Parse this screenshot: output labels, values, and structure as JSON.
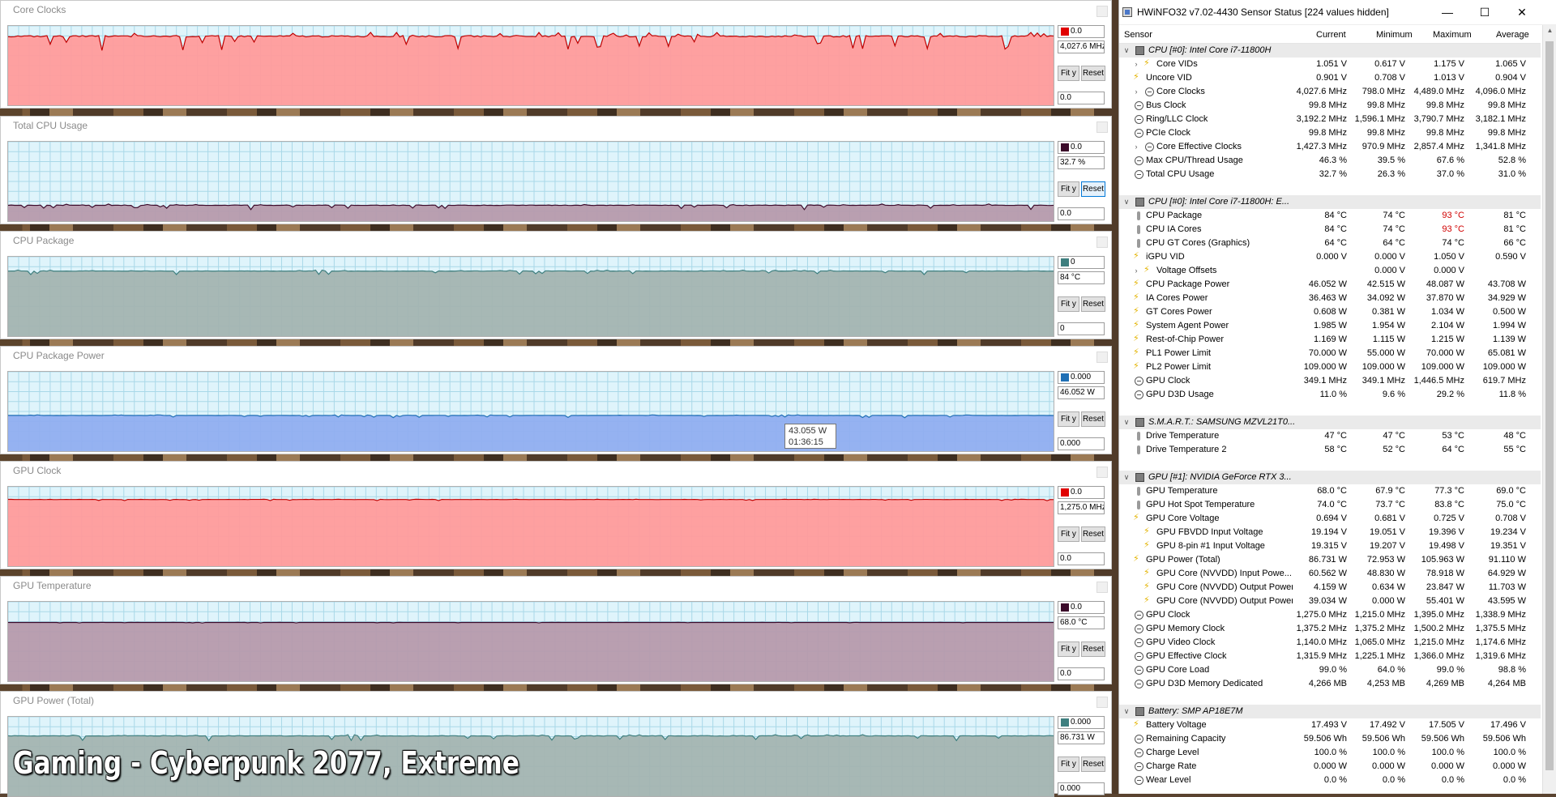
{
  "graphs": [
    {
      "title": "Core Clocks",
      "swatch": "#e00000",
      "fill": "#ff9b9b",
      "line": "#c00000",
      "top_max": "0.0",
      "current": "4,027.6 MHz",
      "min_box": "0.0",
      "fit_label": "Fit y",
      "reset_label": "Reset",
      "level": 0.87,
      "noise": 0.12
    },
    {
      "title": "Total CPU Usage",
      "swatch": "#3b0a2a",
      "fill": "#b69aac",
      "line": "#3b0a2a",
      "top_max": "0.0",
      "current": "32.7 %",
      "min_box": "0.0",
      "fit_label": "Fit y",
      "reset_label": "Reset",
      "level": 0.2,
      "noise": 0.04
    },
    {
      "title": "CPU Package",
      "swatch": "#3e7f7f",
      "fill": "#a3b4b1",
      "line": "#3e7f7f",
      "top_max": "0",
      "current": "84 °C",
      "min_box": "0",
      "fit_label": "Fit y",
      "reset_label": "Reset",
      "level": 0.82,
      "noise": 0.03
    },
    {
      "title": "CPU Package Power",
      "swatch": "#1f6fb5",
      "fill": "#90aef0",
      "line": "#1f6fb5",
      "top_max": "0.000",
      "current": "46.052 W",
      "min_box": "0.000",
      "fit_label": "Fit y",
      "reset_label": "Reset",
      "level": 0.45,
      "noise": 0.02
    },
    {
      "title": "GPU Clock",
      "swatch": "#e00000",
      "fill": "#ff9b9b",
      "line": "#c00000",
      "top_max": "0.0",
      "current": "1,275.0 MHz",
      "min_box": "0.0",
      "fit_label": "Fit y",
      "reset_label": "Reset",
      "level": 0.84,
      "noise": 0.01
    },
    {
      "title": "GPU Temperature",
      "swatch": "#3b0a2a",
      "fill": "#b69aac",
      "line": "#3b0a2a",
      "top_max": "0.0",
      "current": "68.0 °C",
      "min_box": "0.0",
      "fit_label": "Fit y",
      "reset_label": "Reset",
      "level": 0.74,
      "noise": 0.005
    },
    {
      "title": "GPU Power (Total)",
      "swatch": "#3e7f7f",
      "fill": "#a3b4b1",
      "line": "#3e7f7f",
      "top_max": "0.000",
      "current": "86.731 W",
      "min_box": "0.000",
      "fit_label": "Fit y",
      "reset_label": "Reset",
      "level": 0.76,
      "noise": 0.04
    }
  ],
  "tooltip": {
    "value": "43.055 W",
    "time": "01:36:15"
  },
  "caption": "Gaming - Cyberpunk 2077, Extreme",
  "hwinfo": {
    "title": "HWiNFO32 v7.02-4430 Sensor Status [224 values hidden]",
    "minimize_icon": "minimize-icon",
    "columns": {
      "sensor": "Sensor",
      "current": "Current",
      "minimum": "Minimum",
      "maximum": "Maximum",
      "average": "Average"
    },
    "rows": [
      {
        "type": "group",
        "name": "CPU [#0]: Intel Core i7-11800H"
      },
      {
        "type": "item",
        "indent": 2,
        "expand": true,
        "icon": "bolt",
        "name": "Core VIDs",
        "cur": "1.051 V",
        "min": "0.617 V",
        "max": "1.175 V",
        "avg": "1.065 V"
      },
      {
        "type": "item",
        "indent": 1,
        "icon": "bolt",
        "name": "Uncore VID",
        "cur": "0.901 V",
        "min": "0.708 V",
        "max": "1.013 V",
        "avg": "0.904 V"
      },
      {
        "type": "item",
        "indent": 2,
        "expand": true,
        "icon": "clock",
        "name": "Core Clocks",
        "cur": "4,027.6 MHz",
        "min": "798.0 MHz",
        "max": "4,489.0 MHz",
        "avg": "4,096.0 MHz"
      },
      {
        "type": "item",
        "indent": 1,
        "icon": "clock",
        "name": "Bus Clock",
        "cur": "99.8 MHz",
        "min": "99.8 MHz",
        "max": "99.8 MHz",
        "avg": "99.8 MHz"
      },
      {
        "type": "item",
        "indent": 1,
        "icon": "clock",
        "name": "Ring/LLC Clock",
        "cur": "3,192.2 MHz",
        "min": "1,596.1 MHz",
        "max": "3,790.7 MHz",
        "avg": "3,182.1 MHz"
      },
      {
        "type": "item",
        "indent": 1,
        "icon": "clock",
        "name": "PCIe Clock",
        "cur": "99.8 MHz",
        "min": "99.8 MHz",
        "max": "99.8 MHz",
        "avg": "99.8 MHz"
      },
      {
        "type": "item",
        "indent": 2,
        "expand": true,
        "icon": "clock",
        "name": "Core Effective Clocks",
        "cur": "1,427.3 MHz",
        "min": "970.9 MHz",
        "max": "2,857.4 MHz",
        "avg": "1,341.8 MHz"
      },
      {
        "type": "item",
        "indent": 1,
        "icon": "clock",
        "name": "Max CPU/Thread Usage",
        "cur": "46.3 %",
        "min": "39.5 %",
        "max": "67.6 %",
        "avg": "52.8 %"
      },
      {
        "type": "item",
        "indent": 1,
        "icon": "clock",
        "name": "Total CPU Usage",
        "cur": "32.7 %",
        "min": "26.3 %",
        "max": "37.0 %",
        "avg": "31.0 %"
      },
      {
        "type": "blank"
      },
      {
        "type": "group",
        "name": "CPU [#0]: Intel Core i7-11800H: E..."
      },
      {
        "type": "item",
        "indent": 1,
        "icon": "therm",
        "name": "CPU Package",
        "cur": "84 °C",
        "min": "74 °C",
        "max": "93 °C",
        "avg": "81 °C",
        "maxred": true
      },
      {
        "type": "item",
        "indent": 1,
        "icon": "therm",
        "name": "CPU IA Cores",
        "cur": "84 °C",
        "min": "74 °C",
        "max": "93 °C",
        "avg": "81 °C",
        "maxred": true
      },
      {
        "type": "item",
        "indent": 1,
        "icon": "therm",
        "name": "CPU GT Cores (Graphics)",
        "cur": "64 °C",
        "min": "64 °C",
        "max": "74 °C",
        "avg": "66 °C"
      },
      {
        "type": "item",
        "indent": 1,
        "icon": "bolt",
        "name": "iGPU VID",
        "cur": "0.000 V",
        "min": "0.000 V",
        "max": "1.050 V",
        "avg": "0.590 V"
      },
      {
        "type": "item",
        "indent": 2,
        "expand": true,
        "icon": "bolt",
        "name": "Voltage Offsets",
        "cur": "",
        "min": "0.000 V",
        "max": "0.000 V",
        "avg": ""
      },
      {
        "type": "item",
        "indent": 1,
        "icon": "bolt",
        "name": "CPU Package Power",
        "cur": "46.052 W",
        "min": "42.515 W",
        "max": "48.087 W",
        "avg": "43.708 W"
      },
      {
        "type": "item",
        "indent": 1,
        "icon": "bolt",
        "name": "IA Cores Power",
        "cur": "36.463 W",
        "min": "34.092 W",
        "max": "37.870 W",
        "avg": "34.929 W"
      },
      {
        "type": "item",
        "indent": 1,
        "icon": "bolt",
        "name": "GT Cores Power",
        "cur": "0.608 W",
        "min": "0.381 W",
        "max": "1.034 W",
        "avg": "0.500 W"
      },
      {
        "type": "item",
        "indent": 1,
        "icon": "bolt",
        "name": "System Agent Power",
        "cur": "1.985 W",
        "min": "1.954 W",
        "max": "2.104 W",
        "avg": "1.994 W"
      },
      {
        "type": "item",
        "indent": 1,
        "icon": "bolt",
        "name": "Rest-of-Chip Power",
        "cur": "1.169 W",
        "min": "1.115 W",
        "max": "1.215 W",
        "avg": "1.139 W"
      },
      {
        "type": "item",
        "indent": 1,
        "icon": "bolt",
        "name": "PL1 Power Limit",
        "cur": "70.000 W",
        "min": "55.000 W",
        "max": "70.000 W",
        "avg": "65.081 W"
      },
      {
        "type": "item",
        "indent": 1,
        "icon": "bolt",
        "name": "PL2 Power Limit",
        "cur": "109.000 W",
        "min": "109.000 W",
        "max": "109.000 W",
        "avg": "109.000 W"
      },
      {
        "type": "item",
        "indent": 1,
        "icon": "clock",
        "name": "GPU Clock",
        "cur": "349.1 MHz",
        "min": "349.1 MHz",
        "max": "1,446.5 MHz",
        "avg": "619.7 MHz"
      },
      {
        "type": "item",
        "indent": 1,
        "icon": "clock",
        "name": "GPU D3D Usage",
        "cur": "11.0 %",
        "min": "9.6 %",
        "max": "29.2 %",
        "avg": "11.8 %"
      },
      {
        "type": "blank"
      },
      {
        "type": "group",
        "name": "S.M.A.R.T.: SAMSUNG MZVL21T0..."
      },
      {
        "type": "item",
        "indent": 1,
        "icon": "therm",
        "name": "Drive Temperature",
        "cur": "47 °C",
        "min": "47 °C",
        "max": "53 °C",
        "avg": "48 °C"
      },
      {
        "type": "item",
        "indent": 1,
        "icon": "therm",
        "name": "Drive Temperature 2",
        "cur": "58 °C",
        "min": "52 °C",
        "max": "64 °C",
        "avg": "55 °C"
      },
      {
        "type": "blank"
      },
      {
        "type": "group",
        "name": "GPU [#1]: NVIDIA GeForce RTX 3..."
      },
      {
        "type": "item",
        "indent": 1,
        "icon": "therm",
        "name": "GPU Temperature",
        "cur": "68.0 °C",
        "min": "67.9 °C",
        "max": "77.3 °C",
        "avg": "69.0 °C"
      },
      {
        "type": "item",
        "indent": 1,
        "icon": "therm",
        "name": "GPU Hot Spot Temperature",
        "cur": "74.0 °C",
        "min": "73.7 °C",
        "max": "83.8 °C",
        "avg": "75.0 °C"
      },
      {
        "type": "item",
        "indent": 1,
        "icon": "bolt",
        "name": "GPU Core Voltage",
        "cur": "0.694 V",
        "min": "0.681 V",
        "max": "0.725 V",
        "avg": "0.708 V"
      },
      {
        "type": "item",
        "indent": 2,
        "icon": "bolt",
        "name": "GPU FBVDD Input Voltage",
        "cur": "19.194 V",
        "min": "19.051 V",
        "max": "19.396 V",
        "avg": "19.234 V"
      },
      {
        "type": "item",
        "indent": 2,
        "icon": "bolt",
        "name": "GPU 8-pin #1 Input Voltage",
        "cur": "19.315 V",
        "min": "19.207 V",
        "max": "19.498 V",
        "avg": "19.351 V"
      },
      {
        "type": "item",
        "indent": 1,
        "icon": "bolt",
        "name": "GPU Power (Total)",
        "cur": "86.731 W",
        "min": "72.953 W",
        "max": "105.963 W",
        "avg": "91.110 W"
      },
      {
        "type": "item",
        "indent": 2,
        "icon": "bolt",
        "name": "GPU Core (NVVDD) Input Powe...",
        "cur": "60.562 W",
        "min": "48.830 W",
        "max": "78.918 W",
        "avg": "64.929 W"
      },
      {
        "type": "item",
        "indent": 2,
        "icon": "bolt",
        "name": "GPU Core (NVVDD) Output Power",
        "cur": "4.159 W",
        "min": "0.634 W",
        "max": "23.847 W",
        "avg": "11.703 W"
      },
      {
        "type": "item",
        "indent": 2,
        "icon": "bolt",
        "name": "GPU Core (NVVDD) Output Power",
        "cur": "39.034 W",
        "min": "0.000 W",
        "max": "55.401 W",
        "avg": "43.595 W"
      },
      {
        "type": "item",
        "indent": 1,
        "icon": "clock",
        "name": "GPU Clock",
        "cur": "1,275.0 MHz",
        "min": "1,215.0 MHz",
        "max": "1,395.0 MHz",
        "avg": "1,338.9 MHz"
      },
      {
        "type": "item",
        "indent": 1,
        "icon": "clock",
        "name": "GPU Memory Clock",
        "cur": "1,375.2 MHz",
        "min": "1,375.2 MHz",
        "max": "1,500.2 MHz",
        "avg": "1,375.5 MHz"
      },
      {
        "type": "item",
        "indent": 1,
        "icon": "clock",
        "name": "GPU Video Clock",
        "cur": "1,140.0 MHz",
        "min": "1,065.0 MHz",
        "max": "1,215.0 MHz",
        "avg": "1,174.6 MHz"
      },
      {
        "type": "item",
        "indent": 1,
        "icon": "clock",
        "name": "GPU Effective Clock",
        "cur": "1,315.9 MHz",
        "min": "1,225.1 MHz",
        "max": "1,366.0 MHz",
        "avg": "1,319.6 MHz"
      },
      {
        "type": "item",
        "indent": 1,
        "icon": "clock",
        "name": "GPU Core Load",
        "cur": "99.0 %",
        "min": "64.0 %",
        "max": "99.0 %",
        "avg": "98.8 %"
      },
      {
        "type": "item",
        "indent": 1,
        "icon": "clock",
        "name": "GPU D3D Memory Dedicated",
        "cur": "4,266 MB",
        "min": "4,253 MB",
        "max": "4,269 MB",
        "avg": "4,264 MB"
      },
      {
        "type": "blank"
      },
      {
        "type": "group",
        "name": "Battery: SMP  AP18E7M"
      },
      {
        "type": "item",
        "indent": 1,
        "icon": "bolt",
        "name": "Battery Voltage",
        "cur": "17.493 V",
        "min": "17.492 V",
        "max": "17.505 V",
        "avg": "17.496 V"
      },
      {
        "type": "item",
        "indent": 1,
        "icon": "clock",
        "name": "Remaining Capacity",
        "cur": "59.506 Wh",
        "min": "59.506 Wh",
        "max": "59.506 Wh",
        "avg": "59.506 Wh"
      },
      {
        "type": "item",
        "indent": 1,
        "icon": "clock",
        "name": "Charge Level",
        "cur": "100.0 %",
        "min": "100.0 %",
        "max": "100.0 %",
        "avg": "100.0 %"
      },
      {
        "type": "item",
        "indent": 1,
        "icon": "clock",
        "name": "Charge Rate",
        "cur": "0.000 W",
        "min": "0.000 W",
        "max": "0.000 W",
        "avg": "0.000 W"
      },
      {
        "type": "item",
        "indent": 1,
        "icon": "clock",
        "name": "Wear Level",
        "cur": "0.0 %",
        "min": "0.0 %",
        "max": "0.0 %",
        "avg": "0.0 %"
      }
    ]
  }
}
